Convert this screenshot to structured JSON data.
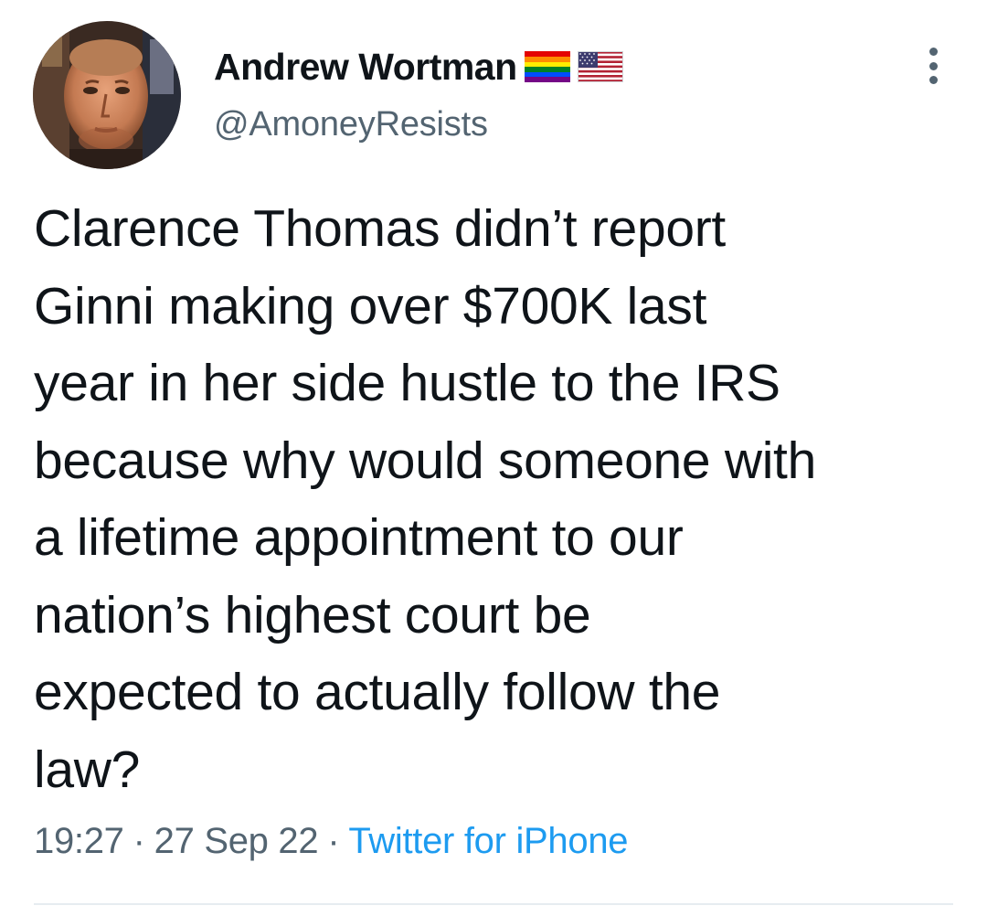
{
  "tweet": {
    "author": {
      "display_name": "Andrew Wortman",
      "handle": "@AmoneyResists",
      "avatar_icon": "profile-photo",
      "flags": [
        "rainbow-flag-icon",
        "us-flag-icon"
      ]
    },
    "text_lines": [
      "Clarence Thomas didn’t report",
      "Ginni making over $700K last",
      "year in her side hustle to the IRS",
      "because why would someone with",
      "a lifetime appointment to our",
      "nation’s highest court be",
      "expected to actually follow the",
      "law?"
    ],
    "time": "19:27",
    "date": "27 Sep 22",
    "separator": "·",
    "source": "Twitter for iPhone",
    "more_icon": "more-vertical-icon"
  },
  "colors": {
    "text": "#0f1419",
    "secondary": "#536471",
    "link": "#1d9bf0",
    "divider": "#e6ecf0"
  }
}
